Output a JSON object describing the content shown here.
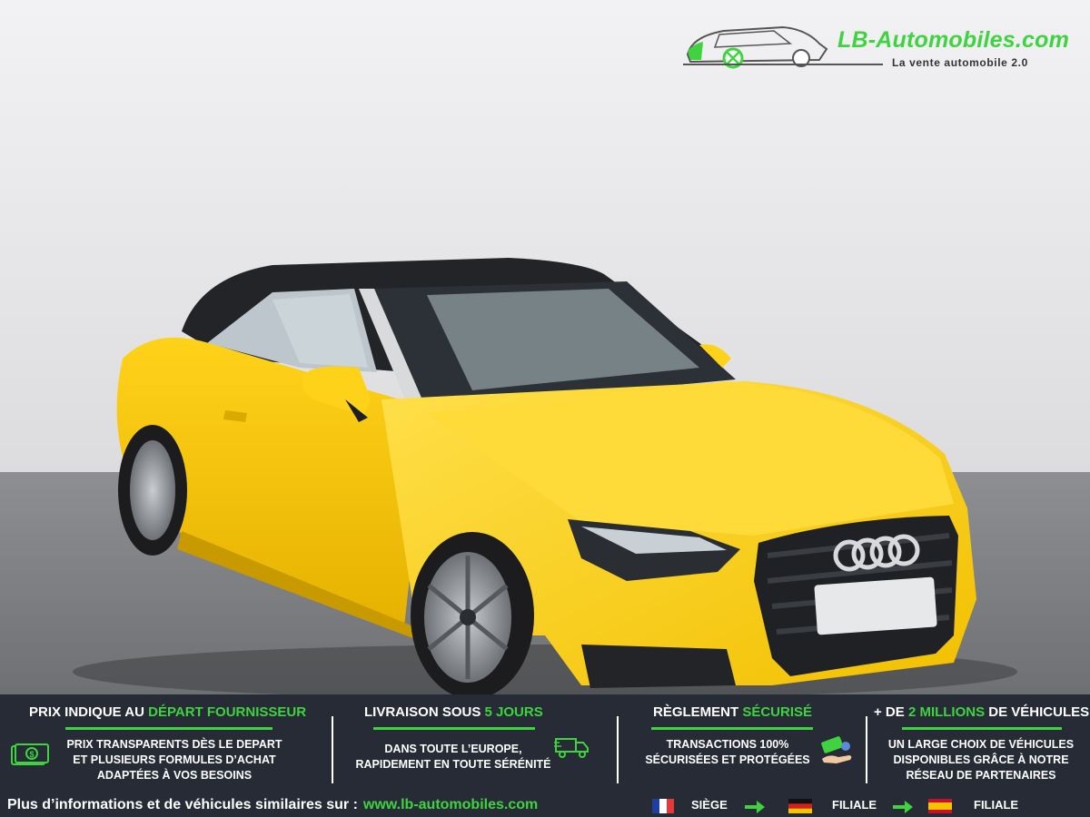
{
  "logo": {
    "brand": "LB-Automobiles.com",
    "tagline": "La vente automobile 2.0"
  },
  "features": [
    {
      "title_pre": "PRIX INDIQUE AU ",
      "title_hl": "DÉPART FOURNISSEUR",
      "title_post": "",
      "text": "PRIX TRANSPARENTS DÈS LE DEPART\nET PLUSIEURS FORMULES D’ACHAT\nADAPTÉES À VOS BESOINS",
      "icon": "money-icon"
    },
    {
      "title_pre": "LIVRAISON SOUS ",
      "title_hl": "5 JOURS",
      "title_post": "",
      "text": "DANS TOUTE L’EUROPE,\nRAPIDEMENT EN TOUTE SÉRÉNITÉ",
      "icon": "truck-icon"
    },
    {
      "title_pre": "RÈGLEMENT ",
      "title_hl": "SÉCURISÉ",
      "title_post": "",
      "text": "TRANSACTIONS 100%\nSÉCURISÉES ET PROTÉGÉES",
      "icon": "payment-icon"
    },
    {
      "title_pre": "+ DE ",
      "title_hl": "2 MILLIONS",
      "title_post": " DE VÉHICULES",
      "text": "UN LARGE CHOIX DE VÉHICULES\nDISPONIBLES GRÂCE À NOTRE\nRÉSEAU DE PARTENAIRES",
      "icon": ""
    }
  ],
  "footer": {
    "text": "Plus d’informations et de véhicules similaires sur :",
    "url": "www.lb-automobiles.com",
    "locations": [
      {
        "flag": "france-flag-icon",
        "label": "SIÈGE"
      },
      {
        "flag": "germany-flag-icon",
        "label": "FILIALE"
      },
      {
        "flag": "spain-flag-icon",
        "label": "FILIALE"
      }
    ]
  },
  "colors": {
    "accent": "#3fd43f",
    "banner_bg": "#262b36",
    "car_body": "#f5c400"
  }
}
